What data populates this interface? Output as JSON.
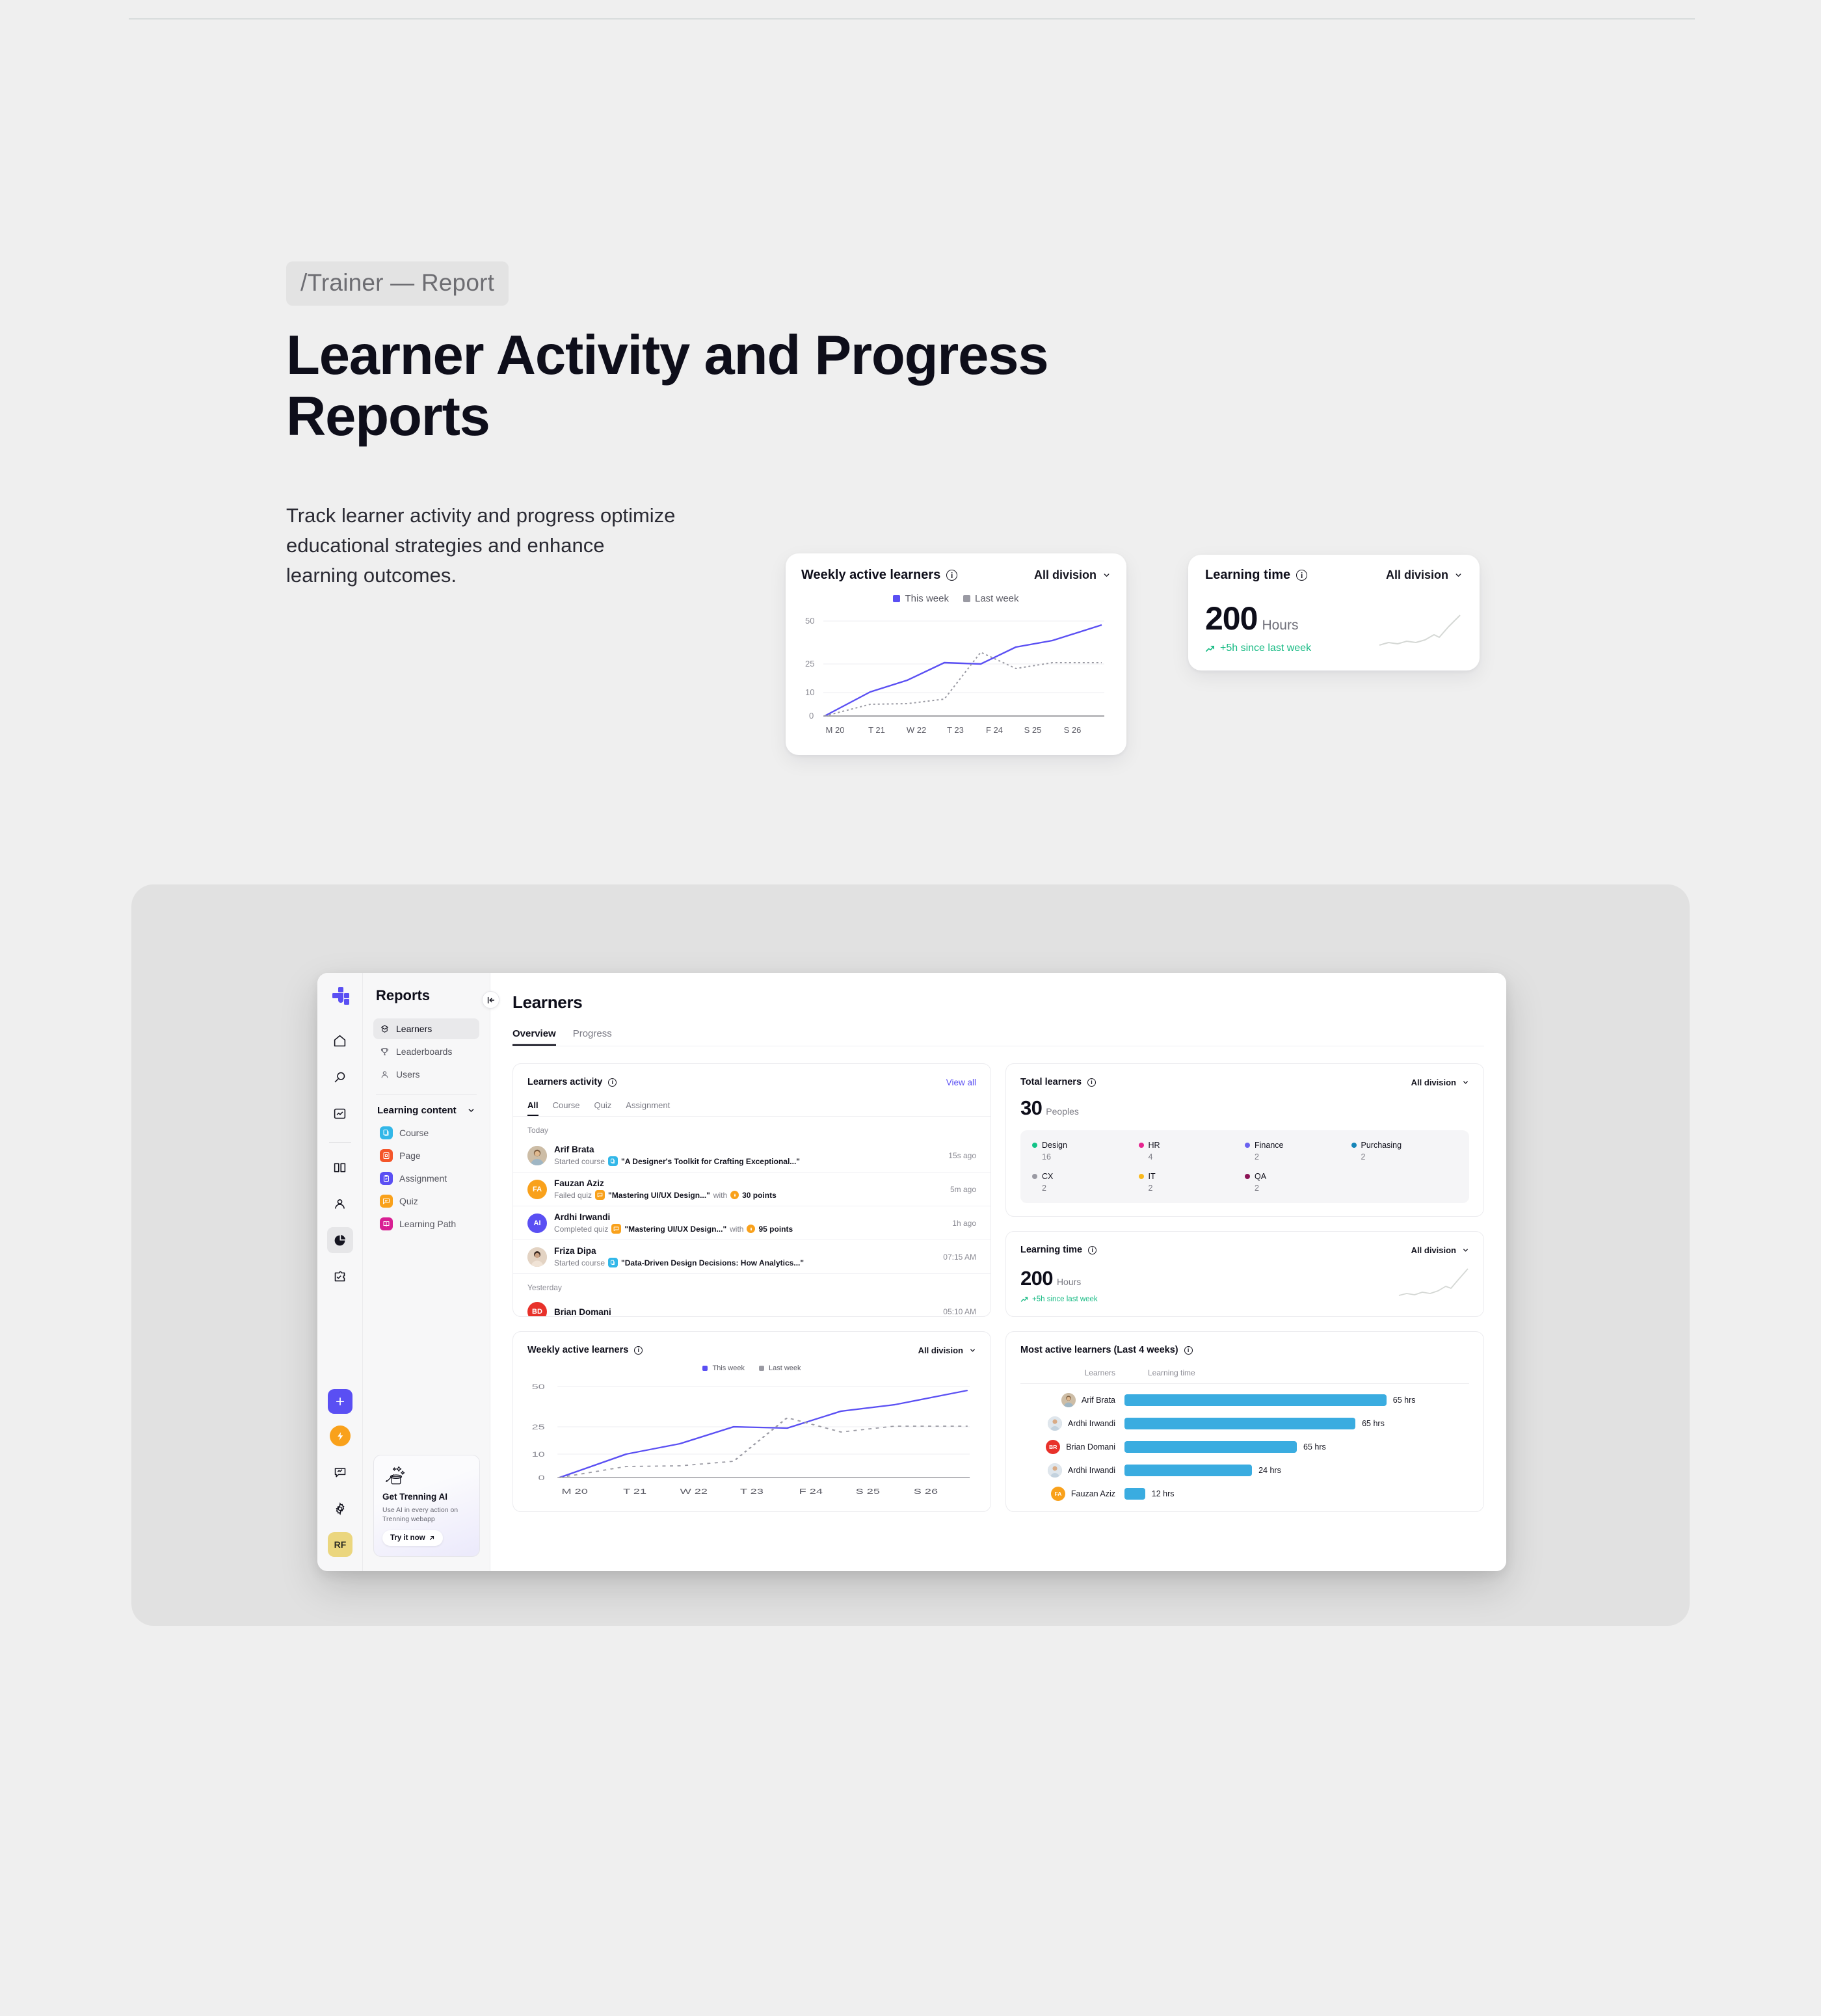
{
  "hero": {
    "breadcrumb": "/Trainer — Report",
    "title": "Learner Activity and Progress Reports",
    "subtitle": "Track learner activity and progress optimize educational strategies and enhance learning outcomes."
  },
  "hero_cards": {
    "weekly": {
      "title": "Weekly active learners",
      "info_icon": "info-icon",
      "division": "All division",
      "chevron_icon": "chevron-down-icon",
      "legend": [
        {
          "label": "This week",
          "color": "#5a4ff3"
        },
        {
          "label": "Last week",
          "color": "#9a9aa3"
        }
      ]
    },
    "learning_time": {
      "title": "Learning time",
      "info_icon": "info-icon",
      "division": "All division",
      "chevron_icon": "chevron-down-icon",
      "value": "200",
      "unit": "Hours",
      "delta": "+5h since last week",
      "delta_icon": "trend-up-icon",
      "delta_color": "#12b981"
    }
  },
  "app": {
    "rail": {
      "logo_icon": "trenning-logo-icon",
      "icons": [
        "home-icon",
        "search-icon",
        "analytics-icon",
        "book-icon",
        "person-icon",
        "pie-chart-icon",
        "puzzle-check-icon"
      ],
      "bottom": {
        "add_icon": "plus-icon",
        "bolt_icon": "bolt-icon",
        "message_icon": "message-chart-icon",
        "settings_icon": "gear-icon",
        "avatar_initials": "RF"
      }
    },
    "nav": {
      "title": "Reports",
      "collapse_icon": "collapse-sidebar-icon",
      "items": [
        {
          "label": "Learners",
          "icon": "learners-icon",
          "active": true
        },
        {
          "label": "Leaderboards",
          "icon": "trophy-icon",
          "active": false
        },
        {
          "label": "Users",
          "icon": "user-icon",
          "active": false
        }
      ],
      "group_label": "Learning content",
      "group_chevron_icon": "chevron-down-icon",
      "content_items": [
        {
          "label": "Course",
          "icon": "course-icon",
          "color": "#32b7e8"
        },
        {
          "label": "Page",
          "icon": "page-icon",
          "color": "#f4562a"
        },
        {
          "label": "Assignment",
          "icon": "assignment-icon",
          "color": "#5a4ff3"
        },
        {
          "label": "Quiz",
          "icon": "quiz-icon",
          "color": "#f9a11b"
        },
        {
          "label": "Learning Path",
          "icon": "learning-path-icon",
          "color": "#d81f93"
        }
      ],
      "promo": {
        "icon": "magic-hat-icon",
        "title": "Get Trenning AI",
        "body": "Use AI in every action on Trenning webapp",
        "button": "Try it now",
        "button_icon": "arrow-up-right-icon"
      }
    },
    "header": {
      "title": "Learners",
      "tabs": [
        {
          "label": "Overview",
          "active": true
        },
        {
          "label": "Progress",
          "active": false
        }
      ]
    },
    "activity": {
      "title": "Learners activity",
      "info_icon": "info-icon",
      "view_all": "View all",
      "filters": [
        {
          "label": "All",
          "active": true
        },
        {
          "label": "Course",
          "active": false
        },
        {
          "label": "Quiz",
          "active": false
        },
        {
          "label": "Assignment",
          "active": false
        }
      ],
      "groups": [
        {
          "day": "Today",
          "rows": [
            {
              "name": "Arif Brata",
              "avatar_type": "photo",
              "avatar_color": "#c6b9ab",
              "initials": "AB",
              "action": "Started course",
              "item_icon": "course-icon",
              "item_color": "#32b7e8",
              "item": "\"A Designer's Toolkit for Crafting Exceptional...\"",
              "points": "",
              "time": "15s ago"
            },
            {
              "name": "Fauzan Aziz",
              "avatar_type": "initials",
              "avatar_color": "#f9a11b",
              "initials": "FA",
              "action": "Failed quiz",
              "item_icon": "quiz-icon",
              "item_color": "#f9a11b",
              "item": "\"Mastering UI/UX Design...\"",
              "points": "30 points",
              "time": "5m ago"
            },
            {
              "name": "Ardhi Irwandi",
              "avatar_type": "initials",
              "avatar_color": "#5a4ff3",
              "initials": "AI",
              "action": "Completed quiz",
              "item_icon": "quiz-icon",
              "item_color": "#f9a11b",
              "item": "\"Mastering UI/UX Design...\"",
              "points": "95 points",
              "time": "1h ago"
            },
            {
              "name": "Friza Dipa",
              "avatar_type": "photo",
              "avatar_color": "#d9c6b4",
              "initials": "FD",
              "action": "Started course",
              "item_icon": "course-icon",
              "item_color": "#32b7e8",
              "item": "\"Data-Driven Design Decisions: How Analytics...\"",
              "points": "",
              "time": "07:15 AM"
            }
          ]
        },
        {
          "day": "Yesterday",
          "rows": [
            {
              "name": "Brian Domani",
              "avatar_type": "initials",
              "avatar_color": "#e8312a",
              "initials": "BD",
              "action": "",
              "item_icon": "",
              "item_color": "",
              "item": "",
              "points": "",
              "time": "05:10 AM"
            }
          ]
        }
      ]
    },
    "total_learners": {
      "title": "Total learners",
      "info_icon": "info-icon",
      "division": "All division",
      "chevron_icon": "chevron-down-icon",
      "value": "30",
      "unit": "Peoples",
      "divisions": [
        {
          "label": "Design",
          "value": "16",
          "color": "#12c387"
        },
        {
          "label": "HR",
          "value": "4",
          "color": "#e6258f"
        },
        {
          "label": "Finance",
          "value": "2",
          "color": "#6a62f0"
        },
        {
          "label": "Purchasing",
          "value": "2",
          "color": "#1585b8"
        },
        {
          "label": "CX",
          "value": "2",
          "color": "#9a9aa3"
        },
        {
          "label": "IT",
          "value": "2",
          "color": "#f9b81b"
        },
        {
          "label": "QA",
          "value": "2",
          "color": "#8c1456"
        }
      ]
    },
    "learning_time": {
      "title": "Learning time",
      "info_icon": "info-icon",
      "division": "All division",
      "chevron_icon": "chevron-down-icon",
      "value": "200",
      "unit": "Hours",
      "delta": "+5h since last week",
      "delta_icon": "trend-up-icon"
    },
    "weekly": {
      "title": "Weekly active learners",
      "info_icon": "info-icon",
      "division": "All division",
      "chevron_icon": "chevron-down-icon"
    },
    "most_active": {
      "title": "Most active learners (Last 4 weeks)",
      "info_icon": "info-icon",
      "col_learners": "Learners",
      "col_time": "Learning time",
      "rows": [
        {
          "name": "Arif Brata",
          "avatar_type": "photo",
          "avatar_color": "#c6b9ab",
          "initials": "AB",
          "value": "65 hrs",
          "pct": 100
        },
        {
          "name": "Ardhi Irwandi",
          "avatar_type": "photo",
          "avatar_color": "#b9c6d2",
          "initials": "AI",
          "value": "65 hrs",
          "pct": 88
        },
        {
          "name": "Brian Domani",
          "avatar_type": "initials",
          "avatar_color": "#e8312a",
          "initials": "BR",
          "value": "65 hrs",
          "pct": 66
        },
        {
          "name": "Ardhi Irwandi",
          "avatar_type": "photo",
          "avatar_color": "#b9c6d2",
          "initials": "AI",
          "value": "24 hrs",
          "pct": 49
        },
        {
          "name": "Fauzan Aziz",
          "avatar_type": "initials",
          "avatar_color": "#f9a11b",
          "initials": "FA",
          "value": "12 hrs",
          "pct": 8
        }
      ]
    }
  },
  "chart_data": [
    {
      "type": "line",
      "id": "weekly-active-learners",
      "title": "Weekly active learners",
      "xlabel": "",
      "ylabel": "",
      "categories": [
        "M 20",
        "T 21",
        "W 22",
        "T 23",
        "F 24",
        "S 25",
        "S 26"
      ],
      "yticks": [
        0,
        10,
        25,
        50
      ],
      "ylim": [
        0,
        50
      ],
      "grid": true,
      "legend_position": "top-center",
      "series": [
        {
          "name": "This week",
          "color": "#5a4ff3",
          "style": "solid",
          "values": [
            0,
            8,
            14,
            19,
            18,
            28,
            33,
            42
          ]
        },
        {
          "name": "Last week",
          "color": "#9a9aa3",
          "style": "dotted",
          "values": [
            0,
            4,
            5,
            7,
            23,
            19,
            26,
            26
          ]
        }
      ]
    },
    {
      "type": "bar",
      "id": "most-active-learners",
      "title": "Most active learners (Last 4 weeks)",
      "orientation": "horizontal",
      "categories": [
        "Arif Brata",
        "Ardhi Irwandi",
        "Brian Domani",
        "Ardhi Irwandi",
        "Fauzan Aziz"
      ],
      "values": [
        65,
        65,
        65,
        24,
        12
      ],
      "value_labels": [
        "65 hrs",
        "65 hrs",
        "65 hrs",
        "24 hrs",
        "12 hrs"
      ],
      "color": "#3aace0",
      "xlabel": "Learning time",
      "ylabel": "Learners"
    },
    {
      "type": "area",
      "id": "learning-time-sparkline",
      "title": "Learning time",
      "values": [
        8,
        9,
        8,
        12,
        10,
        11,
        14,
        13,
        18,
        22,
        30,
        38
      ],
      "color": "#d5d8d5"
    },
    {
      "type": "pie",
      "id": "total-learners-by-division",
      "title": "Total learners",
      "total": 30,
      "categories": [
        "Design",
        "HR",
        "Finance",
        "Purchasing",
        "CX",
        "IT",
        "QA"
      ],
      "values": [
        16,
        4,
        2,
        2,
        2,
        2,
        2
      ],
      "colors": [
        "#12c387",
        "#e6258f",
        "#6a62f0",
        "#1585b8",
        "#9a9aa3",
        "#f9b81b",
        "#8c1456"
      ]
    }
  ]
}
